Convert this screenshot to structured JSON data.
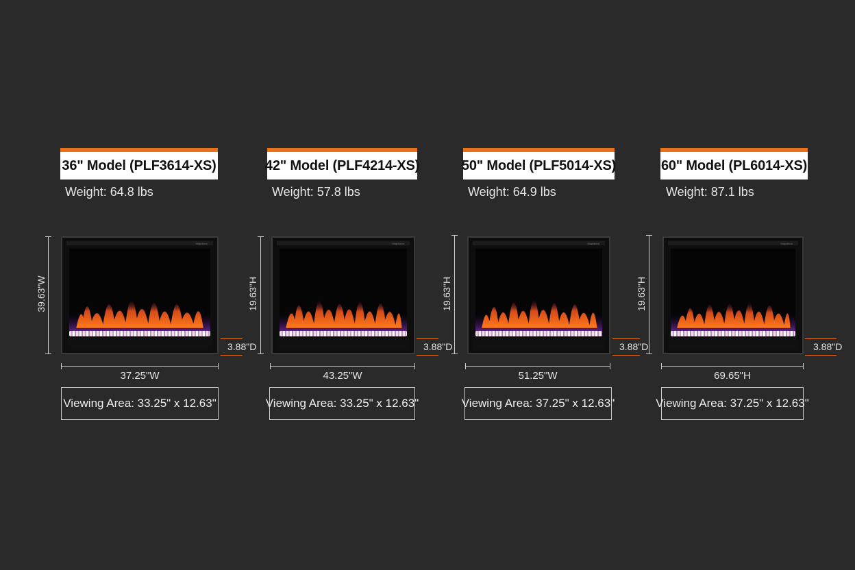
{
  "models": [
    {
      "title": "36\" Model (PLF3614-XS)",
      "weight": "Weight: 64.8 lbs",
      "height_label": "39.63\"W",
      "width_label": "37.25\"W",
      "depth_label": "3.88\"D",
      "viewing_area": "Viewing Area: 33.25\" x 12.63\""
    },
    {
      "title": "42\" Model (PLF4214-XS)",
      "weight": "Weight: 57.8 lbs",
      "height_label": "19.63\"H",
      "width_label": "43.25\"W",
      "depth_label": "3.88\"D",
      "viewing_area": "Viewing Area: 33.25\" x 12.63\""
    },
    {
      "title": "50\" Model (PLF5014-XS)",
      "weight": "Weight: 64.9 lbs",
      "height_label": "19.63\"H",
      "width_label": "51.25\"W",
      "depth_label": "3.88\"D",
      "viewing_area": "Viewing Area: 37.25\" x 12.63\""
    },
    {
      "title": "60\" Model (PL6014-XS)",
      "weight": "Weight: 87.1 lbs",
      "height_label": "19.63\"H",
      "width_label": "69.65\"H",
      "depth_label": "3.88\"D",
      "viewing_area": "Viewing Area: 37.25\" x 12.63\""
    }
  ],
  "colors": {
    "background": "#2a2a2a",
    "accent": "#e8731c",
    "title_box": "#ffffff"
  }
}
